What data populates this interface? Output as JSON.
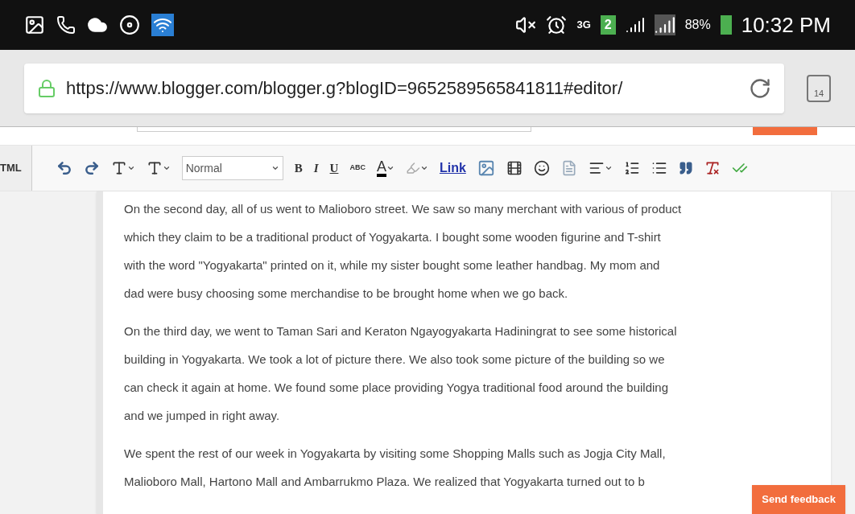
{
  "status_bar": {
    "network": "3G",
    "sim": "2",
    "battery": "88%",
    "time": "10:32 PM"
  },
  "browser": {
    "url": "https://www.blogger.com/blogger.g?blogID=9652589565841811#editor/",
    "tab_count": "14"
  },
  "toolbar": {
    "html_tab": "TML",
    "format": "Normal",
    "bold": "B",
    "italic": "I",
    "underline": "U",
    "strike": "ABC",
    "text_color": "A",
    "link": "Link"
  },
  "paragraphs": [
    {
      "lines": [
        "On the second day, all of us went to Malioboro street. We saw so many merchant with various of product",
        "which they claim to be a traditional product of Yogyakarta. I bought some wooden figurine and T-shirt",
        "with the word \"Yogyakarta\" printed on it, while my sister bought some leather handbag. My mom and",
        "dad were busy choosing some merchandise to be brought home when we go back."
      ]
    },
    {
      "lines": [
        "On the third day, we went to Taman Sari and Keraton Ngayogyakarta Hadiningrat to see some historical",
        "building in Yogyakarta. We took a lot of picture there. We also took some picture of the building so we",
        "can check it again at home. We found some place providing Yogya traditional food around the building",
        "and we jumped in right away."
      ]
    },
    {
      "lines": [
        "We spent the rest of our week in Yogyakarta by visiting some Shopping Malls such as Jogja City Mall,",
        "Malioboro Mall, Hartono Mall and Ambarrukmo Plaza. We realized that Yogyakarta turned out to b"
      ]
    }
  ],
  "feedback_button": "Send feedback"
}
